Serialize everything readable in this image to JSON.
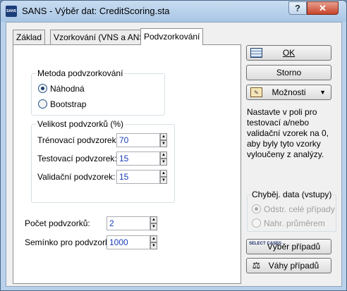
{
  "window": {
    "app_icon": "SANS",
    "title": "SANS - Výběr dat: CreditScoring.sta",
    "help_label": "?",
    "close_label": "✕"
  },
  "tabs": [
    {
      "label": "Základ",
      "active": false
    },
    {
      "label": "Vzorkování (VNS a ANS)",
      "active": false
    },
    {
      "label": "Podvzorkování",
      "active": true
    }
  ],
  "method_group": {
    "title": "Metoda podvzorkování",
    "options": [
      {
        "label": "Náhodná",
        "checked": true
      },
      {
        "label": "Bootstrap",
        "checked": false
      }
    ]
  },
  "size_group": {
    "title": "Velikost podvzorků (%)",
    "fields": [
      {
        "label": "Trénovací podvzorek:",
        "value": "70"
      },
      {
        "label": "Testovací podvzorek:",
        "value": "15"
      },
      {
        "label": "Validační podvzorek:",
        "value": "15"
      }
    ]
  },
  "count_field": {
    "label": "Počet podvzorků:",
    "value": "2"
  },
  "seed_field": {
    "label": "Semínko pro podvzork.:",
    "value": "1000"
  },
  "buttons": {
    "ok": "OK",
    "cancel": "Storno",
    "options": "Možnosti",
    "select_cases": "Výběr případů",
    "select_cases_icon_text": "SELECT CASES",
    "case_weights": "Váhy případů"
  },
  "info_text": "Nastavte v poli pro testovací a/nebo validační vzorek na 0, aby byly tyto vzorky vyloučeny z analýzy.",
  "missing_group": {
    "title": "Chyběj. data (vstupy)",
    "options": [
      {
        "label": "Odstr. celé případy",
        "checked": true,
        "disabled": true
      },
      {
        "label": "Nahr. průměrem",
        "checked": false,
        "disabled": true
      }
    ]
  }
}
